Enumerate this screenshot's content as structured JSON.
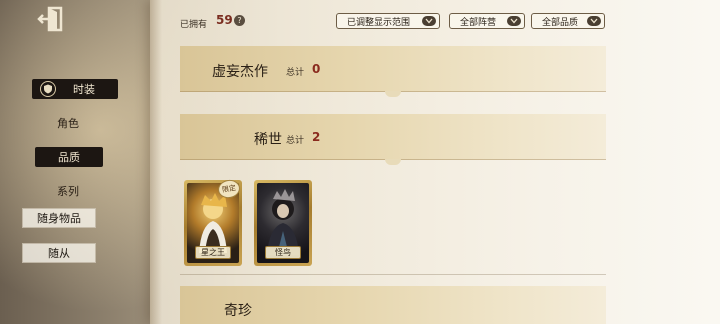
{
  "header": {
    "owned_label": "已拥有",
    "owned_count": "59",
    "help_glyph": "?",
    "filters": [
      {
        "label": "已调整显示范围"
      },
      {
        "label": "全部阵营"
      },
      {
        "label": "全部品质"
      }
    ]
  },
  "sidebar": {
    "items": [
      {
        "label": "时装"
      },
      {
        "label": "角色"
      },
      {
        "label": "品质"
      },
      {
        "label": "系列"
      },
      {
        "label": "随身物品"
      },
      {
        "label": "随从"
      }
    ]
  },
  "categories": [
    {
      "name": "虚妄杰作",
      "total_label": "总计",
      "count": "0"
    },
    {
      "name": "稀世",
      "total_label": "总计",
      "count": "2"
    },
    {
      "name": "奇珍"
    }
  ],
  "cards": [
    {
      "name": "星之王",
      "tag": "限定"
    },
    {
      "name": "怪鸟"
    }
  ],
  "colors": {
    "accent_red": "#8a2a1e",
    "banner_gold": "#e6d6ae",
    "card_gold": "#a67d2e"
  }
}
